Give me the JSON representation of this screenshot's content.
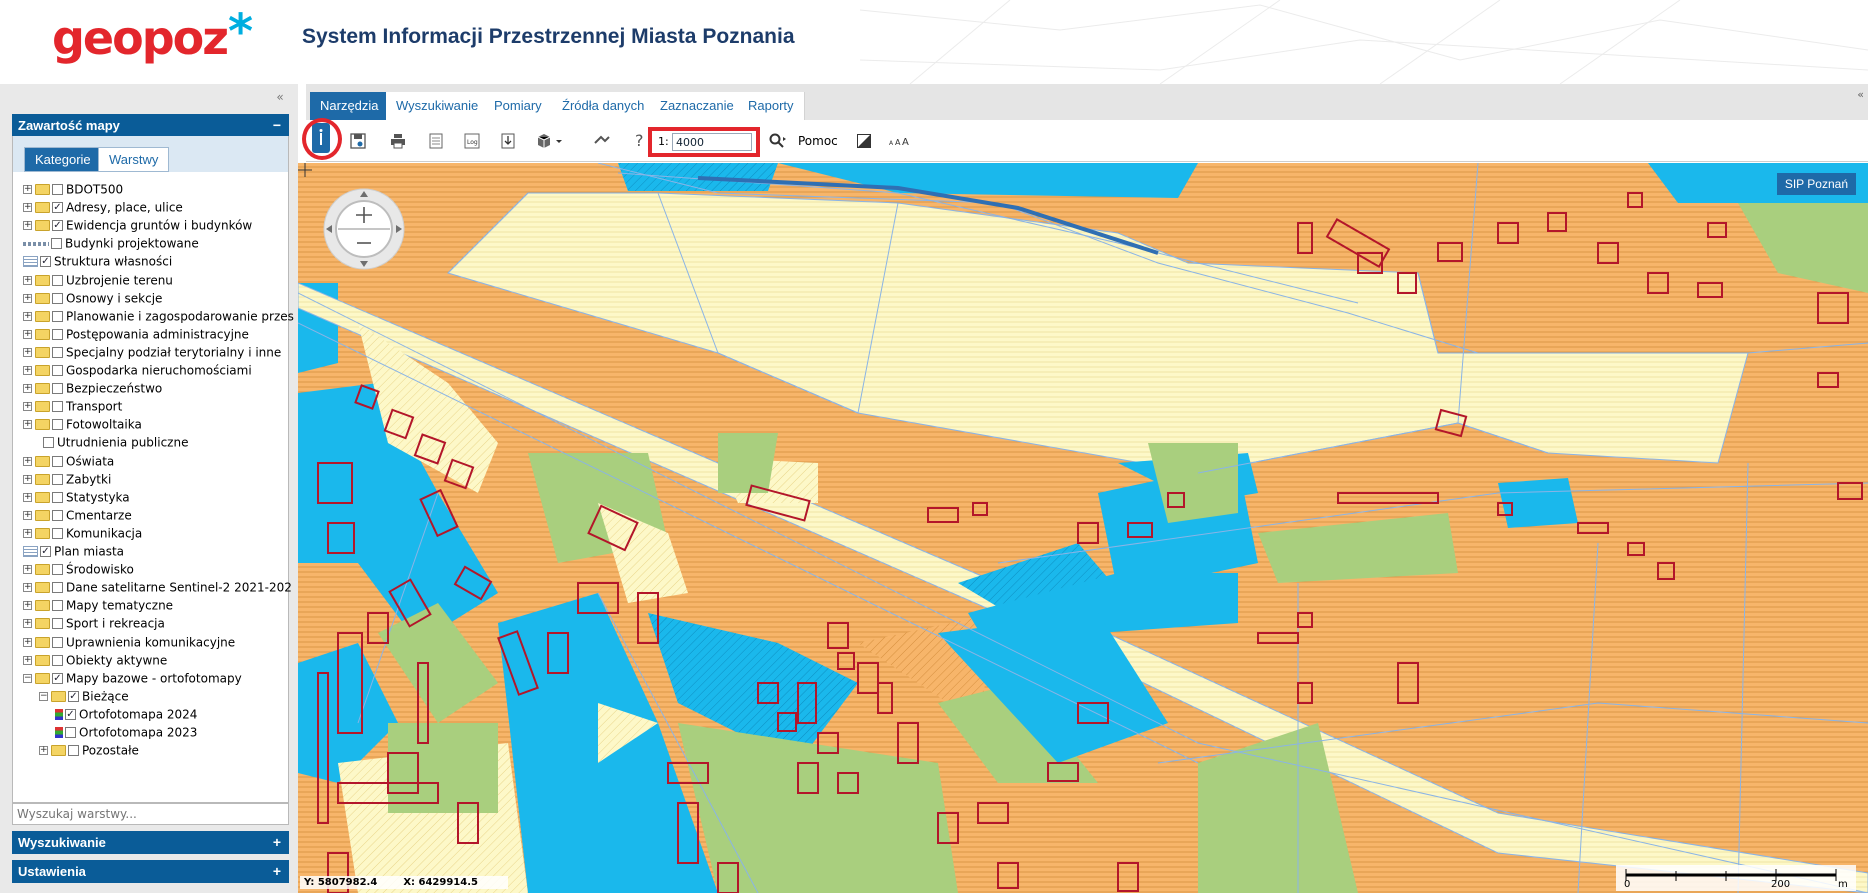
{
  "header": {
    "logo_text": "geopoz",
    "title": "System Informacji Przestrzennej Miasta Poznania"
  },
  "left_panel": {
    "content_header": "Zawartość mapy",
    "content_toggle": "−",
    "tabs": [
      {
        "label": "Kategorie",
        "active": true
      },
      {
        "label": "Warstwy",
        "active": false
      }
    ],
    "tree": [
      {
        "label": "BDOT500",
        "level": 0,
        "type": "folder",
        "expanded": false,
        "checked": false
      },
      {
        "label": "Adresy, place, ulice",
        "level": 0,
        "type": "folder",
        "expanded": false,
        "checked": true
      },
      {
        "label": "Ewidencja gruntów i budynków",
        "level": 0,
        "type": "folder",
        "expanded": false,
        "checked": true
      },
      {
        "label": "Budynki projektowane",
        "level": 0,
        "type": "layer-dash",
        "expanded": null,
        "checked": false
      },
      {
        "label": "Struktura własności",
        "level": 0,
        "type": "layer",
        "expanded": null,
        "checked": true
      },
      {
        "label": "Uzbrojenie terenu",
        "level": 0,
        "type": "folder",
        "expanded": false,
        "checked": false
      },
      {
        "label": "Osnowy i sekcje",
        "level": 0,
        "type": "folder",
        "expanded": false,
        "checked": false
      },
      {
        "label": "Planowanie i zagospodarowanie przes",
        "level": 0,
        "type": "folder",
        "expanded": false,
        "checked": false
      },
      {
        "label": "Postępowania administracyjne",
        "level": 0,
        "type": "folder",
        "expanded": false,
        "checked": false
      },
      {
        "label": "Specjalny podział terytorialny i inne",
        "level": 0,
        "type": "folder",
        "expanded": false,
        "checked": false
      },
      {
        "label": "Gospodarka nieruchomościami",
        "level": 0,
        "type": "folder",
        "expanded": false,
        "checked": false
      },
      {
        "label": "Bezpieczeństwo",
        "level": 0,
        "type": "folder",
        "expanded": false,
        "checked": false
      },
      {
        "label": "Transport",
        "level": 0,
        "type": "folder",
        "expanded": false,
        "checked": false
      },
      {
        "label": "Fotowoltaika",
        "level": 0,
        "type": "folder",
        "expanded": false,
        "checked": false
      },
      {
        "label": "Utrudnienia publiczne",
        "level": 1,
        "type": "plain",
        "expanded": null,
        "checked": false
      },
      {
        "label": "Oświata",
        "level": 0,
        "type": "folder",
        "expanded": false,
        "checked": false
      },
      {
        "label": "Zabytki",
        "level": 0,
        "type": "folder",
        "expanded": false,
        "checked": false
      },
      {
        "label": "Statystyka",
        "level": 0,
        "type": "folder",
        "expanded": false,
        "checked": false
      },
      {
        "label": "Cmentarze",
        "level": 0,
        "type": "folder",
        "expanded": false,
        "checked": false
      },
      {
        "label": "Komunikacja",
        "level": 0,
        "type": "folder",
        "expanded": false,
        "checked": false
      },
      {
        "label": "Plan miasta",
        "level": 0,
        "type": "layer",
        "expanded": null,
        "checked": true
      },
      {
        "label": "Środowisko",
        "level": 0,
        "type": "folder",
        "expanded": false,
        "checked": false
      },
      {
        "label": "Dane satelitarne Sentinel-2 2021-202",
        "level": 0,
        "type": "folder",
        "expanded": false,
        "checked": false
      },
      {
        "label": "Mapy tematyczne",
        "level": 0,
        "type": "folder",
        "expanded": false,
        "checked": false
      },
      {
        "label": "Sport i rekreacja",
        "level": 0,
        "type": "folder",
        "expanded": false,
        "checked": false
      },
      {
        "label": "Uprawnienia komunikacyjne",
        "level": 0,
        "type": "folder",
        "expanded": false,
        "checked": false
      },
      {
        "label": "Obiekty aktywne",
        "level": 0,
        "type": "folder",
        "expanded": false,
        "checked": false
      },
      {
        "label": "Mapy bazowe - ortofotomapy",
        "level": 0,
        "type": "folder",
        "expanded": true,
        "checked": true
      },
      {
        "label": "Bieżące",
        "level": 1,
        "type": "folder",
        "expanded": true,
        "checked": true
      },
      {
        "label": "Ortofotomapa 2024",
        "level": 2,
        "type": "layer-color",
        "expanded": null,
        "checked": true
      },
      {
        "label": "Ortofotomapa 2023",
        "level": 2,
        "type": "layer-color",
        "expanded": null,
        "checked": false
      },
      {
        "label": "Pozostałe",
        "level": 1,
        "type": "folder",
        "expanded": false,
        "checked": false
      }
    ],
    "search_placeholder": "Wyszukaj warstwy...",
    "bottom_panels": [
      {
        "label": "Wyszukiwanie",
        "toggle": "+"
      },
      {
        "label": "Ustawienia",
        "toggle": "+"
      }
    ]
  },
  "tabs": [
    {
      "label": "Narzędzia",
      "active": true
    },
    {
      "label": "Wyszukiwanie",
      "active": false
    },
    {
      "label": "Pomiary",
      "active": false
    },
    {
      "label": "Źródła danych",
      "active": false
    },
    {
      "label": "Zaznaczanie",
      "active": false
    },
    {
      "label": "Raporty",
      "active": false
    }
  ],
  "toolbar": {
    "scale_prefix": "1:",
    "scale_value": "4000",
    "help_label": "Pomoc",
    "icons": [
      "info-icon",
      "save-icon",
      "print-icon",
      "document-icon",
      "log-icon",
      "export-icon",
      "3d-box-icon",
      "measure-arrows-icon",
      "help-question-icon",
      "zoom-icon",
      "contrast-icon",
      "font-size-icon"
    ]
  },
  "map": {
    "sip_button": "SIP Poznań",
    "coord_y": "Y: 5807982.4",
    "coord_x": "X: 6429914.5",
    "scalebar_labels": [
      "0",
      "200",
      "m"
    ]
  },
  "colors": {
    "brand_red": "#e3262c",
    "brand_blue": "#1e6aa8",
    "header_dark_blue": "#0a5c98",
    "map_orange": "#f7b56a",
    "map_yellow": "#fdf8c8",
    "map_cyan": "#1ab8ec",
    "map_green": "#a9cf7e",
    "building_red": "#b3162a"
  }
}
